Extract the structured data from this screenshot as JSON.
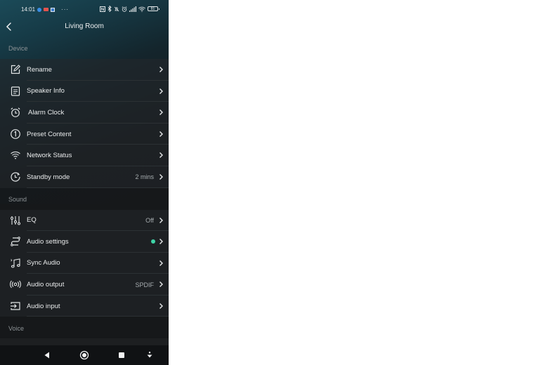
{
  "status_bar": {
    "time": "14:01",
    "notification_icons": [
      "messenger-icon",
      "gmail-icon",
      "app-icon",
      "more-dots-icon"
    ],
    "more": "···",
    "system_icons": [
      "nfc-icon",
      "bluetooth-icon",
      "mute-icon",
      "alarm-icon",
      "signal-icon",
      "wifi-icon",
      "battery-icon"
    ],
    "battery": "81"
  },
  "app_bar": {
    "title": "Living Room",
    "back_icon": "back-chevron-icon"
  },
  "sections": {
    "device": {
      "header": "Device",
      "items": [
        {
          "label": "Rename",
          "icon": "edit-icon",
          "value": ""
        },
        {
          "label": "Speaker Info",
          "icon": "document-icon",
          "value": ""
        },
        {
          "label": "Alarm Clock",
          "icon": "alarm-clock-icon",
          "value": ""
        },
        {
          "label": "Preset Content",
          "icon": "preset-number-icon",
          "value": ""
        },
        {
          "label": "Network Status",
          "icon": "wifi-icon",
          "value": ""
        },
        {
          "label": "Standby mode",
          "icon": "timer-icon",
          "value": "2 mins"
        }
      ]
    },
    "sound": {
      "header": "Sound",
      "items": [
        {
          "label": "EQ",
          "icon": "equalizer-icon",
          "value": "Off"
        },
        {
          "label": "Audio settings",
          "icon": "audio-settings-icon",
          "value": "",
          "indicator_color": "#3ed3a6"
        },
        {
          "label": "Sync Audio",
          "icon": "music-note-icon",
          "value": ""
        },
        {
          "label": "Audio output",
          "icon": "broadcast-icon",
          "value": "SPDIF"
        },
        {
          "label": "Audio input",
          "icon": "input-icon",
          "value": ""
        }
      ]
    },
    "voice": {
      "header": "Voice"
    }
  },
  "nav_bar": {
    "buttons": [
      "back-triangle-icon",
      "home-circle-icon",
      "recents-square-icon",
      "hide-nav-icon"
    ]
  },
  "colors": {
    "accent_indicator": "#3ed3a6",
    "background": "#16181a",
    "header_gradient": "#1b4a58"
  }
}
